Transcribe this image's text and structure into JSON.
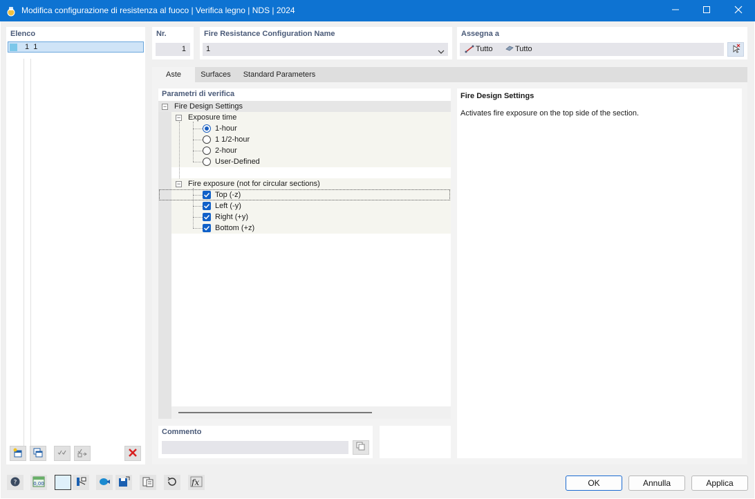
{
  "window": {
    "title": "Modifica configurazione di resistenza al fuoco | Verifica legno | NDS | 2024",
    "icons": [
      "app-icon",
      "minimize-icon",
      "maximize-icon",
      "close-icon"
    ]
  },
  "list_panel": {
    "label": "Elenco",
    "items": [
      {
        "id": "1",
        "name": "1",
        "color": "#7cc7ea",
        "selected": true
      }
    ]
  },
  "nr": {
    "label": "Nr.",
    "value": "1"
  },
  "config_name": {
    "label": "Fire Resistance Configuration Name",
    "value": "1"
  },
  "assign": {
    "label": "Assegna a",
    "members_value": "Tutto",
    "surfaces_value": "Tutto"
  },
  "tabs": [
    {
      "label": "Aste",
      "active": true
    },
    {
      "label": "Surfaces",
      "active": false
    },
    {
      "label": "Standard Parameters",
      "active": false
    }
  ],
  "params": {
    "label": "Parametri di verifica",
    "group": "Fire Design Settings",
    "exposure_time": {
      "label": "Exposure time",
      "options": [
        {
          "label": "1-hour",
          "selected": true
        },
        {
          "label": "1 1/2-hour",
          "selected": false
        },
        {
          "label": "2-hour",
          "selected": false
        },
        {
          "label": "User-Defined",
          "selected": false
        }
      ]
    },
    "fire_exposure": {
      "label": "Fire exposure (not for circular sections)",
      "options": [
        {
          "label": "Top (-z)",
          "checked": true
        },
        {
          "label": "Left (-y)",
          "checked": true
        },
        {
          "label": "Right (+y)",
          "checked": true
        },
        {
          "label": "Bottom (+z)",
          "checked": true
        }
      ]
    }
  },
  "info": {
    "title": "Fire Design Settings",
    "text": "Activates fire exposure on the top side of the section."
  },
  "comment": {
    "label": "Commento",
    "value": ""
  },
  "buttons": {
    "ok": "OK",
    "cancel": "Annulla",
    "apply": "Applica"
  },
  "accent_color": "#0e73d2"
}
